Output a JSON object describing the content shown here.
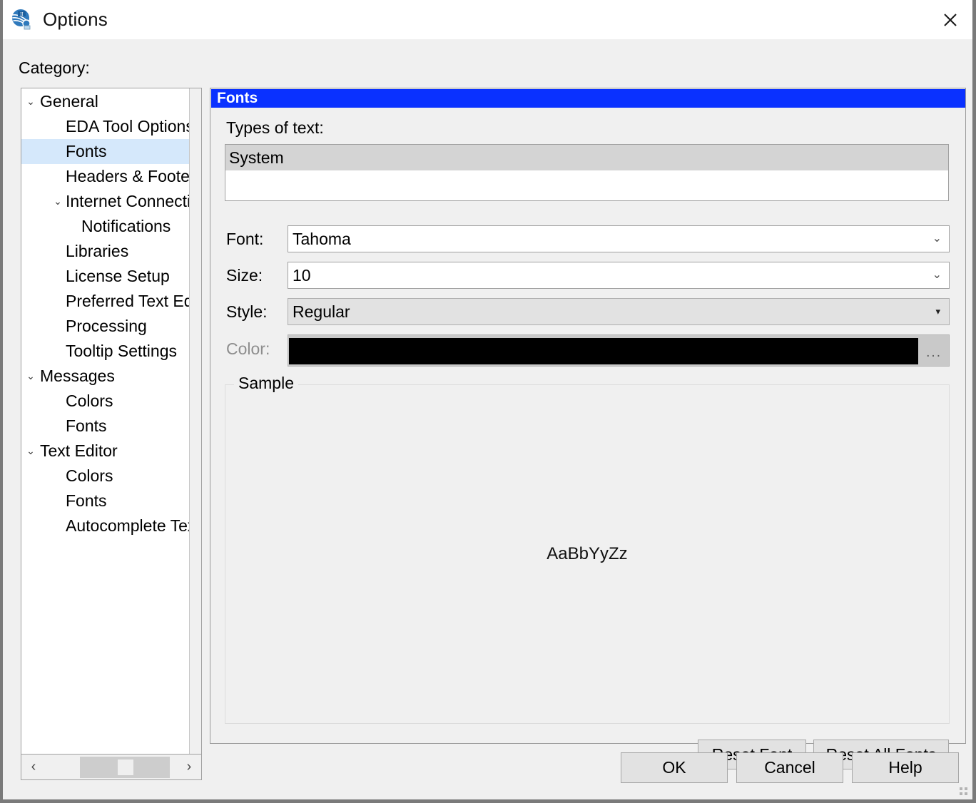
{
  "window": {
    "title": "Options",
    "icon": "app-globe-icon",
    "close_label": "✕"
  },
  "category": {
    "label": "Category:",
    "tree": [
      {
        "label": "General",
        "level": 0,
        "twisty": "⌄",
        "selected": false
      },
      {
        "label": "EDA Tool Options",
        "level": 1,
        "twisty": "",
        "selected": false
      },
      {
        "label": "Fonts",
        "level": 1,
        "twisty": "",
        "selected": true
      },
      {
        "label": "Headers & Footers",
        "level": 1,
        "twisty": "",
        "selected": false
      },
      {
        "label": "Internet Connectivity",
        "level": 1,
        "twisty": "⌄",
        "selected": false
      },
      {
        "label": "Notifications",
        "level": 2,
        "twisty": "",
        "selected": false
      },
      {
        "label": "Libraries",
        "level": 1,
        "twisty": "",
        "selected": false
      },
      {
        "label": "License Setup",
        "level": 1,
        "twisty": "",
        "selected": false
      },
      {
        "label": "Preferred Text Editor",
        "level": 1,
        "twisty": "",
        "selected": false
      },
      {
        "label": "Processing",
        "level": 1,
        "twisty": "",
        "selected": false
      },
      {
        "label": "Tooltip Settings",
        "level": 1,
        "twisty": "",
        "selected": false
      },
      {
        "label": "Messages",
        "level": 0,
        "twisty": "⌄",
        "selected": false
      },
      {
        "label": "Colors",
        "level": 1,
        "twisty": "",
        "selected": false
      },
      {
        "label": "Fonts",
        "level": 1,
        "twisty": "",
        "selected": false
      },
      {
        "label": "Text Editor",
        "level": 0,
        "twisty": "⌄",
        "selected": false
      },
      {
        "label": "Colors",
        "level": 1,
        "twisty": "",
        "selected": false
      },
      {
        "label": "Fonts",
        "level": 1,
        "twisty": "",
        "selected": false
      },
      {
        "label": "Autocomplete Text",
        "level": 1,
        "twisty": "",
        "selected": false
      }
    ],
    "scrollbar": {
      "left_arrow": "‹",
      "right_arrow": "›"
    }
  },
  "panel": {
    "header": "Fonts",
    "types_of_text": {
      "label": "Types of text:",
      "items": [
        "System"
      ],
      "selected": "System"
    },
    "font": {
      "label": "Font:",
      "value": "Tahoma",
      "caret": "⌄"
    },
    "size": {
      "label": "Size:",
      "value": "10",
      "caret": "⌄"
    },
    "style": {
      "label": "Style:",
      "value": "Regular",
      "caret": "▾"
    },
    "color": {
      "label": "Color:",
      "value": "#000000",
      "picker_label": "...",
      "disabled": true
    },
    "sample": {
      "legend": "Sample",
      "text": "AaBbYyZz"
    },
    "reset_font_label": "Reset Font",
    "reset_all_fonts_label": "Reset All Fonts"
  },
  "footer": {
    "ok_label": "OK",
    "cancel_label": "Cancel",
    "help_label": "Help"
  },
  "colors": {
    "header_blue": "#0a31ff",
    "selection_blue": "#d5e8fb",
    "list_selection_gray": "#d4d4d4",
    "dialog_bg": "#f0f0f0",
    "color_swatch": "#000000"
  }
}
